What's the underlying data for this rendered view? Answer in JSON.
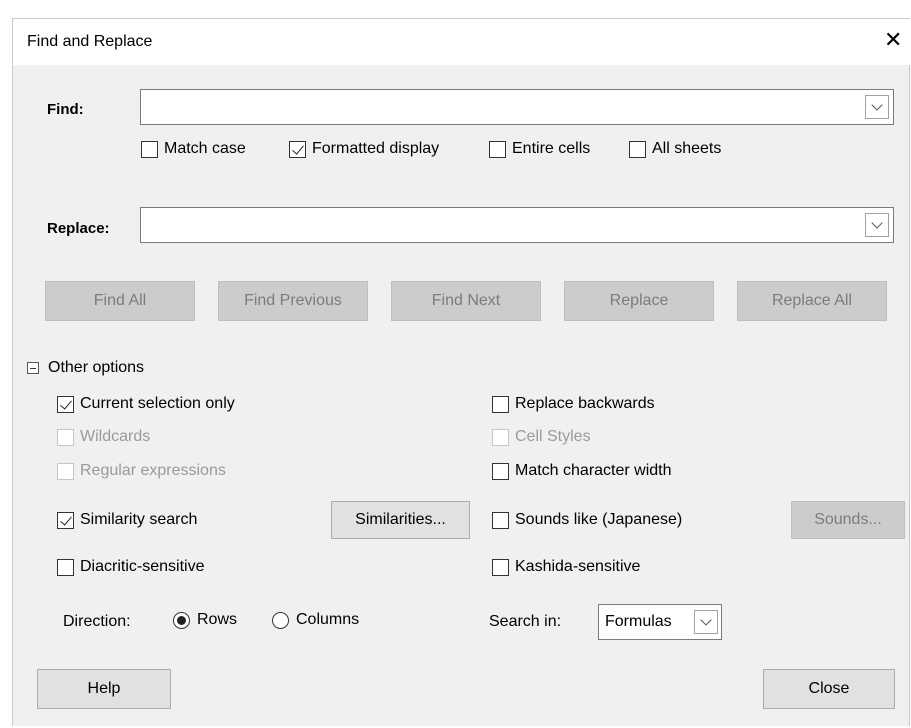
{
  "window": {
    "title": "Find and Replace",
    "close_glyph": "✕"
  },
  "find": {
    "label": "Find:",
    "value": "",
    "options": [
      {
        "label": "Match case",
        "checked": false
      },
      {
        "label": "Formatted display",
        "checked": true
      },
      {
        "label": "Entire cells",
        "checked": false
      },
      {
        "label": "All sheets",
        "checked": false
      }
    ]
  },
  "replace": {
    "label": "Replace:",
    "value": ""
  },
  "actions": {
    "find_all": "Find All",
    "find_previous": "Find Previous",
    "find_next": "Find Next",
    "replace": "Replace",
    "replace_all": "Replace All"
  },
  "other_options": {
    "header": "Other options",
    "left": {
      "current_selection_only": {
        "label": "Current selection only",
        "checked": true
      },
      "wildcards": {
        "label": "Wildcards",
        "checked": false,
        "disabled": true
      },
      "regular_expressions": {
        "label": "Regular expressions",
        "checked": false,
        "disabled": true
      },
      "similarity_search": {
        "label": "Similarity search",
        "checked": true
      },
      "diacritic_sensitive": {
        "label": "Diacritic-sensitive",
        "checked": false
      }
    },
    "similarities_button": "Similarities...",
    "right": {
      "replace_backwards": {
        "label": "Replace backwards",
        "checked": false
      },
      "cell_styles": {
        "label": "Cell Styles",
        "checked": false,
        "disabled": true
      },
      "match_character_width": {
        "label": "Match character width",
        "checked": false
      },
      "sounds_like": {
        "label": "Sounds like (Japanese)",
        "checked": false
      },
      "kashida_sensitive": {
        "label": "Kashida-sensitive",
        "checked": false
      }
    },
    "sounds_button": "Sounds...",
    "direction": {
      "label": "Direction:",
      "options": [
        "Rows",
        "Columns"
      ],
      "selected": "Rows"
    },
    "search_in": {
      "label": "Search in:",
      "value": "Formulas"
    }
  },
  "footer": {
    "help": "Help",
    "close": "Close"
  }
}
